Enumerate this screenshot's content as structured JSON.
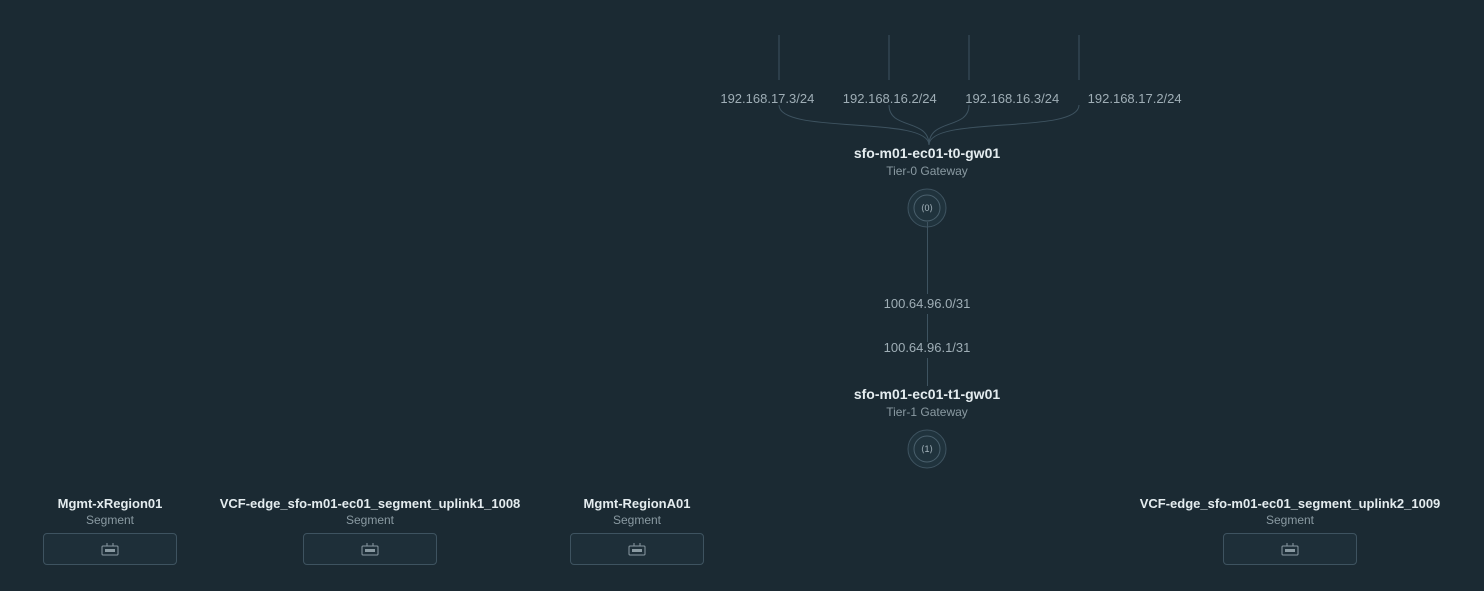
{
  "uplink_ips": {
    "ip1": "192.168.17.3/24",
    "ip2": "192.168.16.2/24",
    "ip3": "192.168.16.3/24",
    "ip4": "192.168.17.2/24"
  },
  "tier0": {
    "name": "sfo-m01-ec01-t0-gw01",
    "type": "Tier-0 Gateway"
  },
  "link": {
    "ip_top": "100.64.96.0/31",
    "ip_bottom": "100.64.96.1/31"
  },
  "tier1": {
    "name": "sfo-m01-ec01-t1-gw01",
    "type": "Tier-1 Gateway"
  },
  "segments": {
    "s1": {
      "name": "Mgmt-xRegion01",
      "type": "Segment"
    },
    "s2": {
      "name": "VCF-edge_sfo-m01-ec01_segment_uplink1_1008",
      "type": "Segment"
    },
    "s3": {
      "name": "Mgmt-RegionA01",
      "type": "Segment"
    },
    "s4": {
      "name": "VCF-edge_sfo-m01-ec01_segment_uplink2_1009",
      "type": "Segment"
    }
  }
}
